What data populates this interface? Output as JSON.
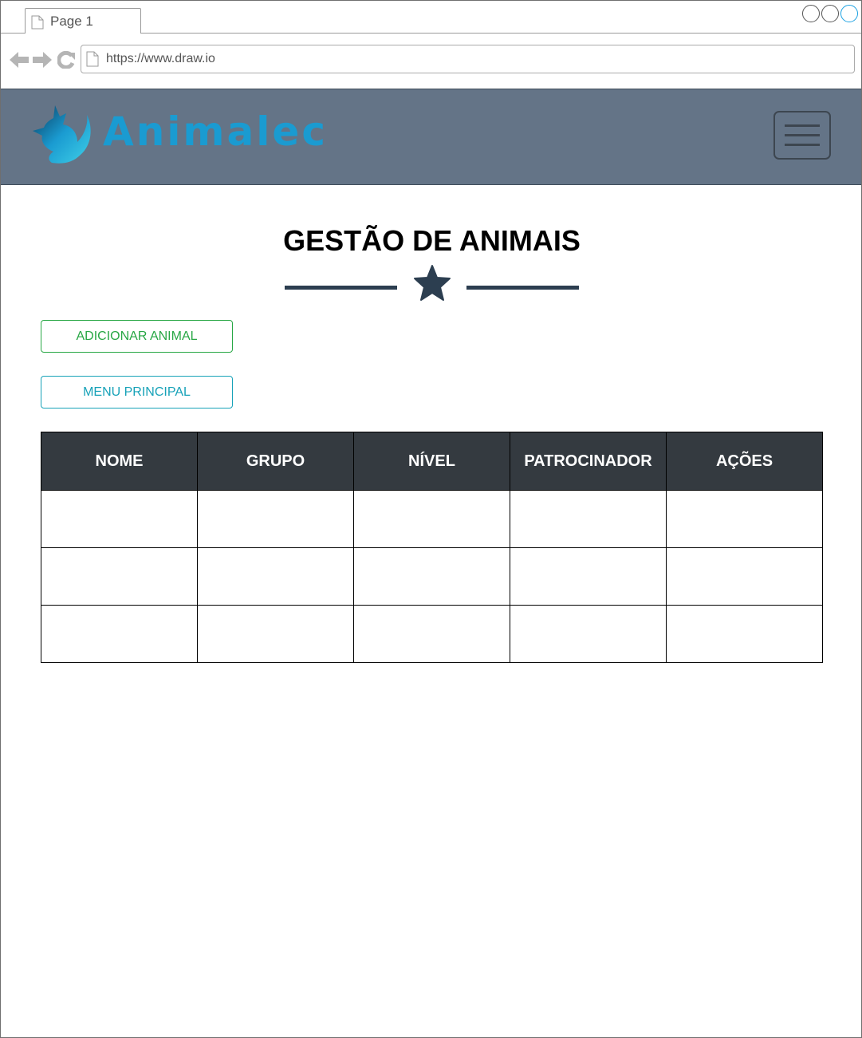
{
  "browser": {
    "tab_label": "Page 1",
    "url": "https://www.draw.io"
  },
  "header": {
    "brand": "Animalec",
    "brand_color": "#1a9bd1",
    "background_color": "#647487",
    "menu_icon": "hamburger-icon"
  },
  "page": {
    "title": "GESTÃO DE ANIMAIS",
    "divider_icon": "star-icon"
  },
  "actions": {
    "add_label": "ADICIONAR ANIMAL",
    "add_color": "#28a745",
    "menu_label": "MENU PRINCIPAL",
    "menu_color": "#17a2b8"
  },
  "table": {
    "headers": [
      "NOME",
      "GRUPO",
      "NÍVEL",
      "PATROCINADOR",
      "AÇÕES"
    ],
    "rows": [
      [
        "",
        "",
        "",
        "",
        ""
      ],
      [
        "",
        "",
        "",
        "",
        ""
      ],
      [
        "",
        "",
        "",
        "",
        ""
      ]
    ]
  }
}
